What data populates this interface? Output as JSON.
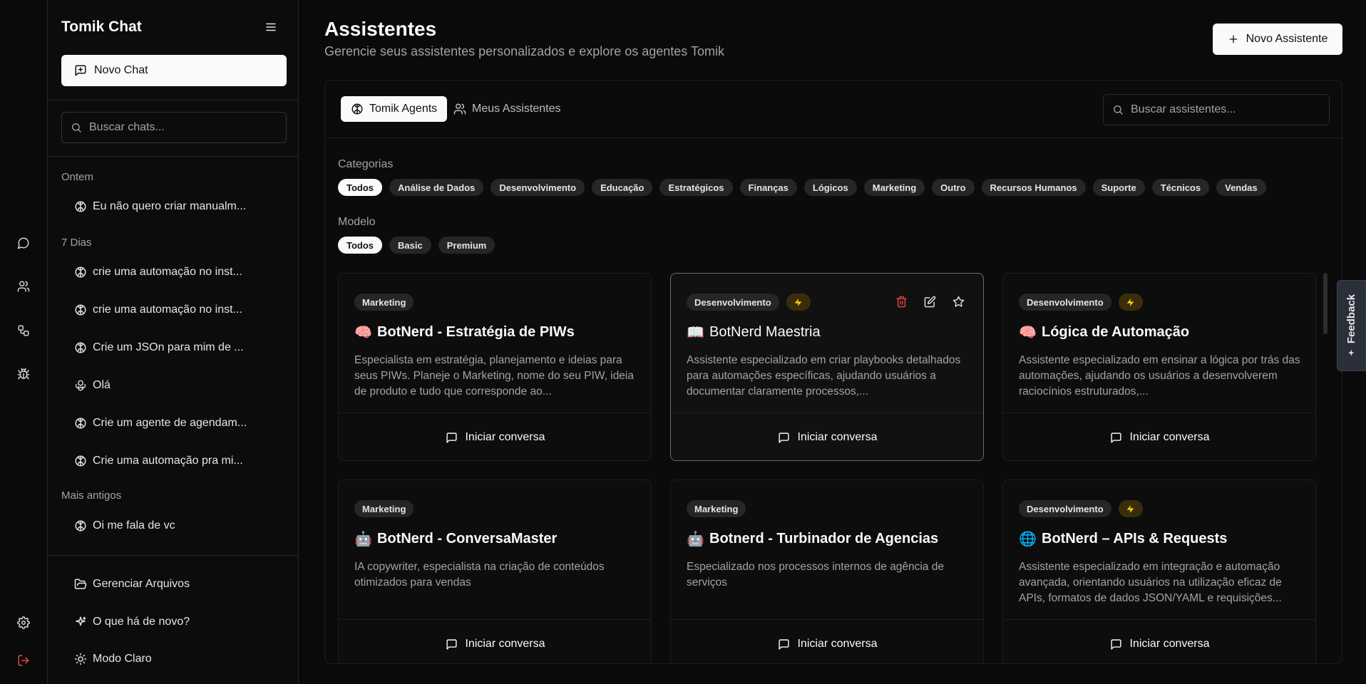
{
  "sidebar": {
    "title": "Tomik Chat",
    "new_chat_label": "Novo Chat",
    "search_placeholder": "Buscar chats...",
    "groups": [
      {
        "label": "Ontem",
        "items": [
          "Eu não quero criar manualm..."
        ]
      },
      {
        "label": "7 Dias",
        "items": [
          "crie uma automação no inst...",
          "crie uma automação no inst...",
          "Crie um JSOn para mim de ...",
          "Olá",
          "Crie um agente de agendam...",
          "Crie uma automação pra mi..."
        ]
      },
      {
        "label": "Mais antigos",
        "items": [
          "Oi me fala de vc"
        ]
      }
    ],
    "footer": {
      "files": "Gerenciar Arquivos",
      "whats_new": "O que há de novo?",
      "theme": "Modo Claro"
    }
  },
  "main": {
    "title": "Assistentes",
    "subtitle": "Gerencie seus assistentes personalizados e explore os agentes Tomik",
    "new_button": "Novo Assistente",
    "tabs": [
      {
        "label": "Tomik Agents",
        "active": true
      },
      {
        "label": "Meus Assistentes",
        "active": false
      }
    ],
    "search_placeholder": "Buscar assistentes...",
    "filters": {
      "category_label": "Categorias",
      "categories": [
        "Todos",
        "Análise de Dados",
        "Desenvolvimento",
        "Educação",
        "Estratégicos",
        "Finanças",
        "Lógicos",
        "Marketing",
        "Outro",
        "Recursos Humanos",
        "Suporte",
        "Técnicos",
        "Vendas"
      ],
      "model_label": "Modelo",
      "models": [
        "Todos",
        "Basic",
        "Premium"
      ]
    },
    "cta_label": "Iniciar conversa",
    "cards": [
      {
        "category": "Marketing",
        "premium": false,
        "emoji": "🧠",
        "title": "BotNerd - Estratégia de PIWs",
        "description": "Especialista em estratégia, planejamento e ideias para seus PIWs. Planeje o Marketing, nome do seu PIW, ideia de produto e tudo que corresponde ao..."
      },
      {
        "category": "Desenvolvimento",
        "premium": true,
        "emoji": "📖",
        "title": "BotNerd Maestria",
        "description": "Assistente especializado em criar playbooks detalhados para automações específicas, ajudando usuários a documentar claramente processos,..."
      },
      {
        "category": "Desenvolvimento",
        "premium": true,
        "emoji": "🧠",
        "title": "Lógica de Automação",
        "description": "Assistente especializado em ensinar a lógica por trás das automações, ajudando os usuários a desenvolverem raciocínios estruturados,..."
      },
      {
        "category": "Marketing",
        "premium": false,
        "emoji": "🤖",
        "title": "BotNerd - ConversaMaster",
        "description": "IA copywriter, especialista na criação de conteúdos otimizados para vendas"
      },
      {
        "category": "Marketing",
        "premium": false,
        "emoji": "🤖",
        "title": "Botnerd - Turbinador de Agencias",
        "description": "Especializado nos processos internos de agência de serviços"
      },
      {
        "category": "Desenvolvimento",
        "premium": true,
        "emoji": "🌐",
        "title": "BotNerd – APIs & Requests",
        "description": "Assistente especializado em integração e automação avançada, orientando usuários na utilização eficaz de APIs, formatos de dados JSON/YAML e requisições..."
      }
    ]
  },
  "feedback_label": "Feedback",
  "colors": {
    "accent": "#fafafa",
    "premium": "#facc15",
    "danger": "#ef4444",
    "logout": "#ef4444"
  }
}
